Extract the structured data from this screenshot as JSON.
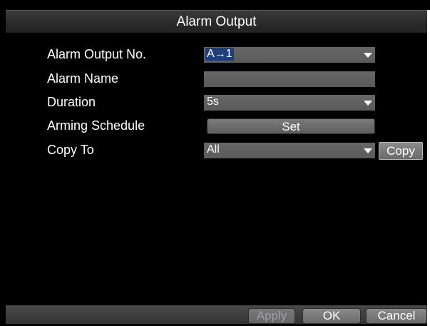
{
  "window": {
    "title": "Alarm Output"
  },
  "form": {
    "alarm_output_no": {
      "label": "Alarm Output No.",
      "value": "A→1"
    },
    "alarm_name": {
      "label": "Alarm Name",
      "value": ""
    },
    "duration": {
      "label": "Duration",
      "value": "5s"
    },
    "arming_schedule": {
      "label": "Arming Schedule",
      "button": "Set"
    },
    "copy_to": {
      "label": "Copy To",
      "value": "All",
      "button": "Copy"
    }
  },
  "footer": {
    "apply": "Apply",
    "ok": "OK",
    "cancel": "Cancel"
  },
  "colors": {
    "field_bg": "#5f5f5f",
    "selection": "#1f3f7a",
    "text": "#ffffff"
  }
}
